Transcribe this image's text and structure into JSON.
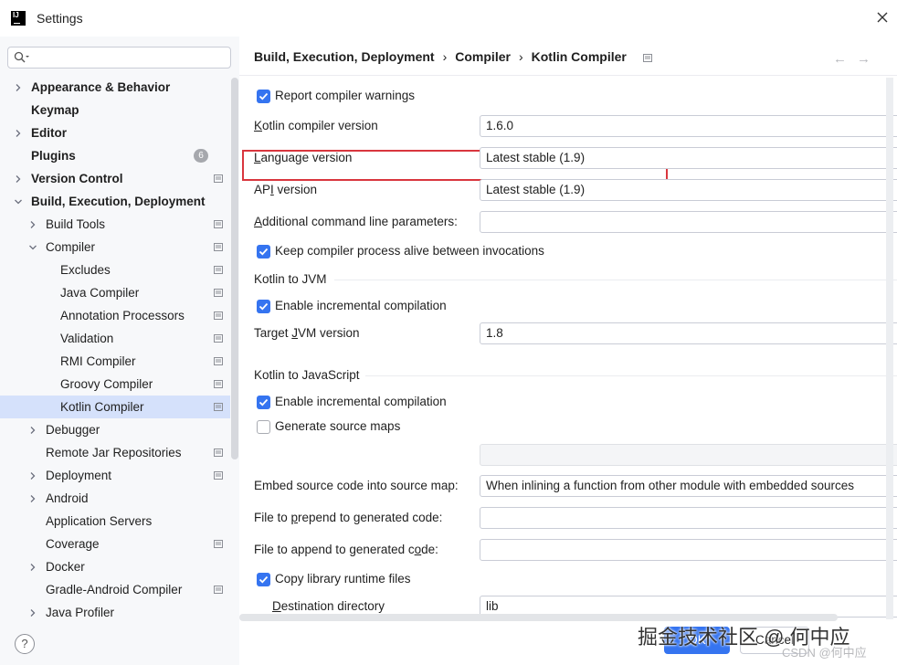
{
  "window": {
    "logo": "IJ",
    "title": "Settings",
    "close_icon": "close-icon"
  },
  "sidebar": {
    "search_placeholder": "",
    "items": [
      {
        "label": "Appearance & Behavior",
        "bold": true,
        "arrow": "right",
        "indent": 0
      },
      {
        "label": "Keymap",
        "bold": true,
        "arrow": "",
        "indent": 0
      },
      {
        "label": "Editor",
        "bold": true,
        "arrow": "right",
        "indent": 0
      },
      {
        "label": "Plugins",
        "bold": true,
        "arrow": "",
        "indent": 0,
        "badge": "6"
      },
      {
        "label": "Version Control",
        "bold": true,
        "arrow": "right",
        "indent": 0,
        "pin": true
      },
      {
        "label": "Build, Execution, Deployment",
        "bold": true,
        "arrow": "down",
        "indent": 0
      },
      {
        "label": "Build Tools",
        "arrow": "right",
        "indent": 1,
        "pin": true
      },
      {
        "label": "Compiler",
        "arrow": "down",
        "indent": 1,
        "pin": true
      },
      {
        "label": "Excludes",
        "indent": 2,
        "pin": true
      },
      {
        "label": "Java Compiler",
        "indent": 2,
        "pin": true
      },
      {
        "label": "Annotation Processors",
        "indent": 2,
        "pin": true
      },
      {
        "label": "Validation",
        "indent": 2,
        "pin": true
      },
      {
        "label": "RMI Compiler",
        "indent": 2,
        "pin": true
      },
      {
        "label": "Groovy Compiler",
        "indent": 2,
        "pin": true
      },
      {
        "label": "Kotlin Compiler",
        "indent": 2,
        "pin": true,
        "selected": true
      },
      {
        "label": "Debugger",
        "arrow": "right",
        "indent": 1
      },
      {
        "label": "Remote Jar Repositories",
        "indent": 1,
        "pin": true
      },
      {
        "label": "Deployment",
        "arrow": "right",
        "indent": 1,
        "pin": true
      },
      {
        "label": "Android",
        "arrow": "right",
        "indent": 1
      },
      {
        "label": "Application Servers",
        "indent": 1
      },
      {
        "label": "Coverage",
        "indent": 1,
        "pin": true
      },
      {
        "label": "Docker",
        "arrow": "right",
        "indent": 1
      },
      {
        "label": "Gradle-Android Compiler",
        "indent": 1,
        "pin": true
      },
      {
        "label": "Java Profiler",
        "arrow": "right",
        "indent": 1
      }
    ],
    "help_label": "?"
  },
  "breadcrumb": {
    "parts": [
      "Build, Execution, Deployment",
      "Compiler",
      "Kotlin Compiler"
    ],
    "separator": "›",
    "back": "←",
    "forward": "→"
  },
  "settings": {
    "report_warnings": {
      "label": "Report compiler warnings",
      "checked": true
    },
    "kotlin_compiler_version": {
      "label_mnemonic": "K",
      "label_rest": "otlin compiler version",
      "value": "1.6.0"
    },
    "language_version": {
      "label_mnemonic": "L",
      "label_rest": "anguage version",
      "value": "Latest stable (1.9)"
    },
    "api_version": {
      "label_pre": "AP",
      "label_mnemonic": "I",
      "label_rest": " version",
      "value": "Latest stable (1.9)"
    },
    "additional_params": {
      "label_mnemonic": "A",
      "label_rest": "dditional command line parameters:",
      "value": ""
    },
    "keep_alive": {
      "label": "Keep compiler process alive between invocations",
      "checked": true
    },
    "kotlin_to_jvm": {
      "title": "Kotlin to JVM",
      "incremental": {
        "label": "Enable incremental compilation",
        "checked": true
      },
      "target_jvm": {
        "label_pre": "Target ",
        "label_mnemonic": "J",
        "label_rest": "VM version",
        "value": "1.8"
      }
    },
    "kotlin_to_js": {
      "title": "Kotlin to JavaScript",
      "incremental": {
        "label": "Enable incremental compilation",
        "checked": true
      },
      "source_maps": {
        "label": "Generate source maps",
        "checked": false
      },
      "source_map_prefix": "",
      "embed_source": {
        "label": "Embed source code into source map:",
        "value": "When inlining a function from other module with embedded sources"
      },
      "prepend": {
        "label_pre": "File to ",
        "label_mnemonic": "p",
        "label_rest": "repend to generated code:",
        "value": ""
      },
      "append": {
        "label_pre": "File to append to generated c",
        "label_mnemonic": "o",
        "label_rest": "de:",
        "value": ""
      },
      "copy_runtime": {
        "label": "Copy library runtime files",
        "checked": true
      },
      "destination": {
        "label_mnemonic": "D",
        "label_rest": "estination directory",
        "value": "lib"
      }
    }
  },
  "buttons": {
    "ok": "OK",
    "cancel": "Cancel"
  },
  "watermark": {
    "text": "掘金技术社区 @ 何中应",
    "text2": "CSDN @何中应"
  },
  "colors": {
    "accent": "#3574f0",
    "highlight_box": "#d9363e",
    "selection": "#d5e1fb"
  }
}
